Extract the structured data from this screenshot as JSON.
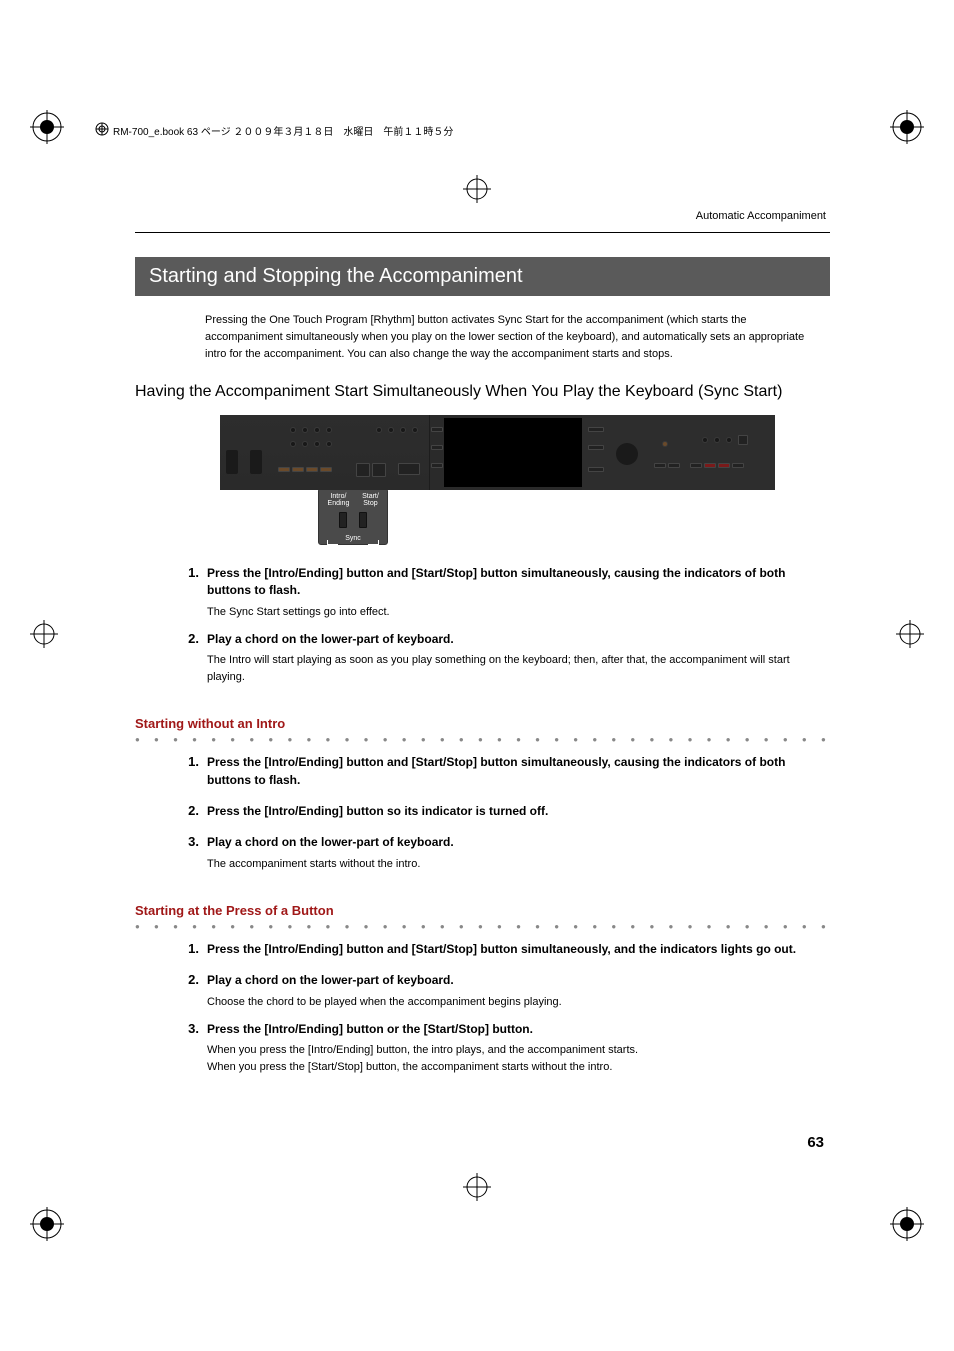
{
  "print_header": "RM-700_e.book  63 ページ  ２００９年３月１８日　水曜日　午前１１時５分",
  "section_label": "Automatic Accompaniment",
  "section_title": "Starting and Stopping the Accompaniment",
  "intro_paragraph": "Pressing the One Touch Program [Rhythm] button activates Sync Start for the accompaniment (which starts the accompaniment simultaneously when you play on the lower section of the keyboard), and automatically sets an appropriate intro for the accompaniment. You can also change the way the accompaniment starts and stops.",
  "subheading1": "Having the Accompaniment Start Simultaneously When You Play the Keyboard (Sync Start)",
  "callout": {
    "label_left": "Intro/ Ending",
    "label_right": "Start/ Stop",
    "sync": "Sync"
  },
  "steps_a": [
    {
      "num": "1.",
      "title": "Press the [Intro/Ending] button and [Start/Stop] button simultaneously, causing the indicators of both buttons to flash.",
      "text": "The Sync Start settings go into effect."
    },
    {
      "num": "2.",
      "title": "Play a chord on the lower-part of keyboard.",
      "text": "The Intro will start playing as soon as you play something on the keyboard; then, after that, the accompaniment will start playing."
    }
  ],
  "red_heading_b": "Starting without an Intro",
  "steps_b": [
    {
      "num": "1.",
      "title": "Press the [Intro/Ending] button and [Start/Stop] button simultaneously, causing the indicators of both buttons to flash.",
      "text": ""
    },
    {
      "num": "2.",
      "title": "Press the [Intro/Ending] button so its indicator is turned off.",
      "text": ""
    },
    {
      "num": "3.",
      "title": "Play a chord on the lower-part of keyboard.",
      "text": "The accompaniment starts without the intro."
    }
  ],
  "red_heading_c": "Starting at the Press of a Button",
  "steps_c": [
    {
      "num": "1.",
      "title": "Press the [Intro/Ending] button and [Start/Stop] button simultaneously, and the indicators lights go out.",
      "text": ""
    },
    {
      "num": "2.",
      "title": "Play a chord on the lower-part of keyboard.",
      "text": "Choose the chord to be played when the accompaniment begins playing."
    },
    {
      "num": "3.",
      "title": "Press the [Intro/Ending] button or the [Start/Stop] button.",
      "text": "When you press the [Intro/Ending] button, the intro plays, and the accompaniment starts.\nWhen you press the [Start/Stop] button, the accompaniment starts without the intro."
    }
  ],
  "page_number": "63",
  "dots": "● ● ● ● ● ● ● ● ● ● ● ● ● ● ● ● ● ● ● ● ● ● ● ● ● ● ● ● ● ● ● ● ● ● ● ● ● ● ● ● ● ● ● ● ● ● ● ● ● ● ● ● ● ● ● ● ● ● ● ● ● ● ● ● ● ● ● ● ● ● ● ● ● ● ● ● ● ● ● ●"
}
